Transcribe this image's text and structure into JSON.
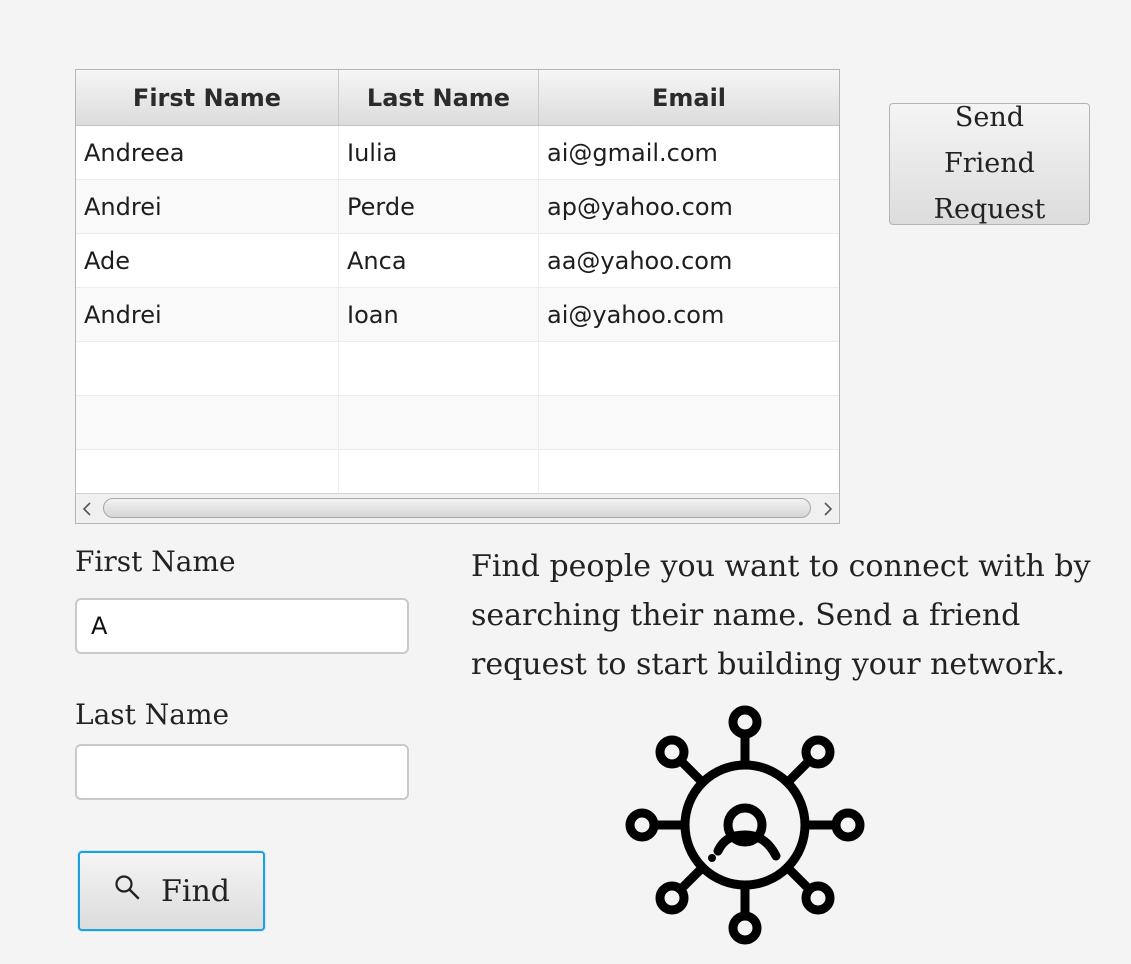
{
  "table": {
    "columns": [
      "First Name",
      "Last Name",
      "Email"
    ],
    "rows": [
      [
        "Andreea",
        "Iulia",
        "ai@gmail.com"
      ],
      [
        "Andrei",
        "Perde",
        "ap@yahoo.com"
      ],
      [
        "Ade",
        "Anca",
        "aa@yahoo.com"
      ],
      [
        "Andrei",
        "Ioan",
        "ai@yahoo.com"
      ]
    ]
  },
  "send_request_button": {
    "label": "Send Friend Request"
  },
  "form": {
    "first_name_label": "First Name",
    "first_name_value": "A",
    "last_name_label": "Last Name",
    "last_name_value": ""
  },
  "find_button": {
    "label": "Find",
    "icon": "search-icon"
  },
  "description": "Find people you want to connect with by searching their name.  Send a friend request to start building your network.",
  "illustration": {
    "icon": "network-user-icon"
  },
  "colors": {
    "background": "#f4f4f4",
    "focus_accent": "#1ea0df"
  }
}
